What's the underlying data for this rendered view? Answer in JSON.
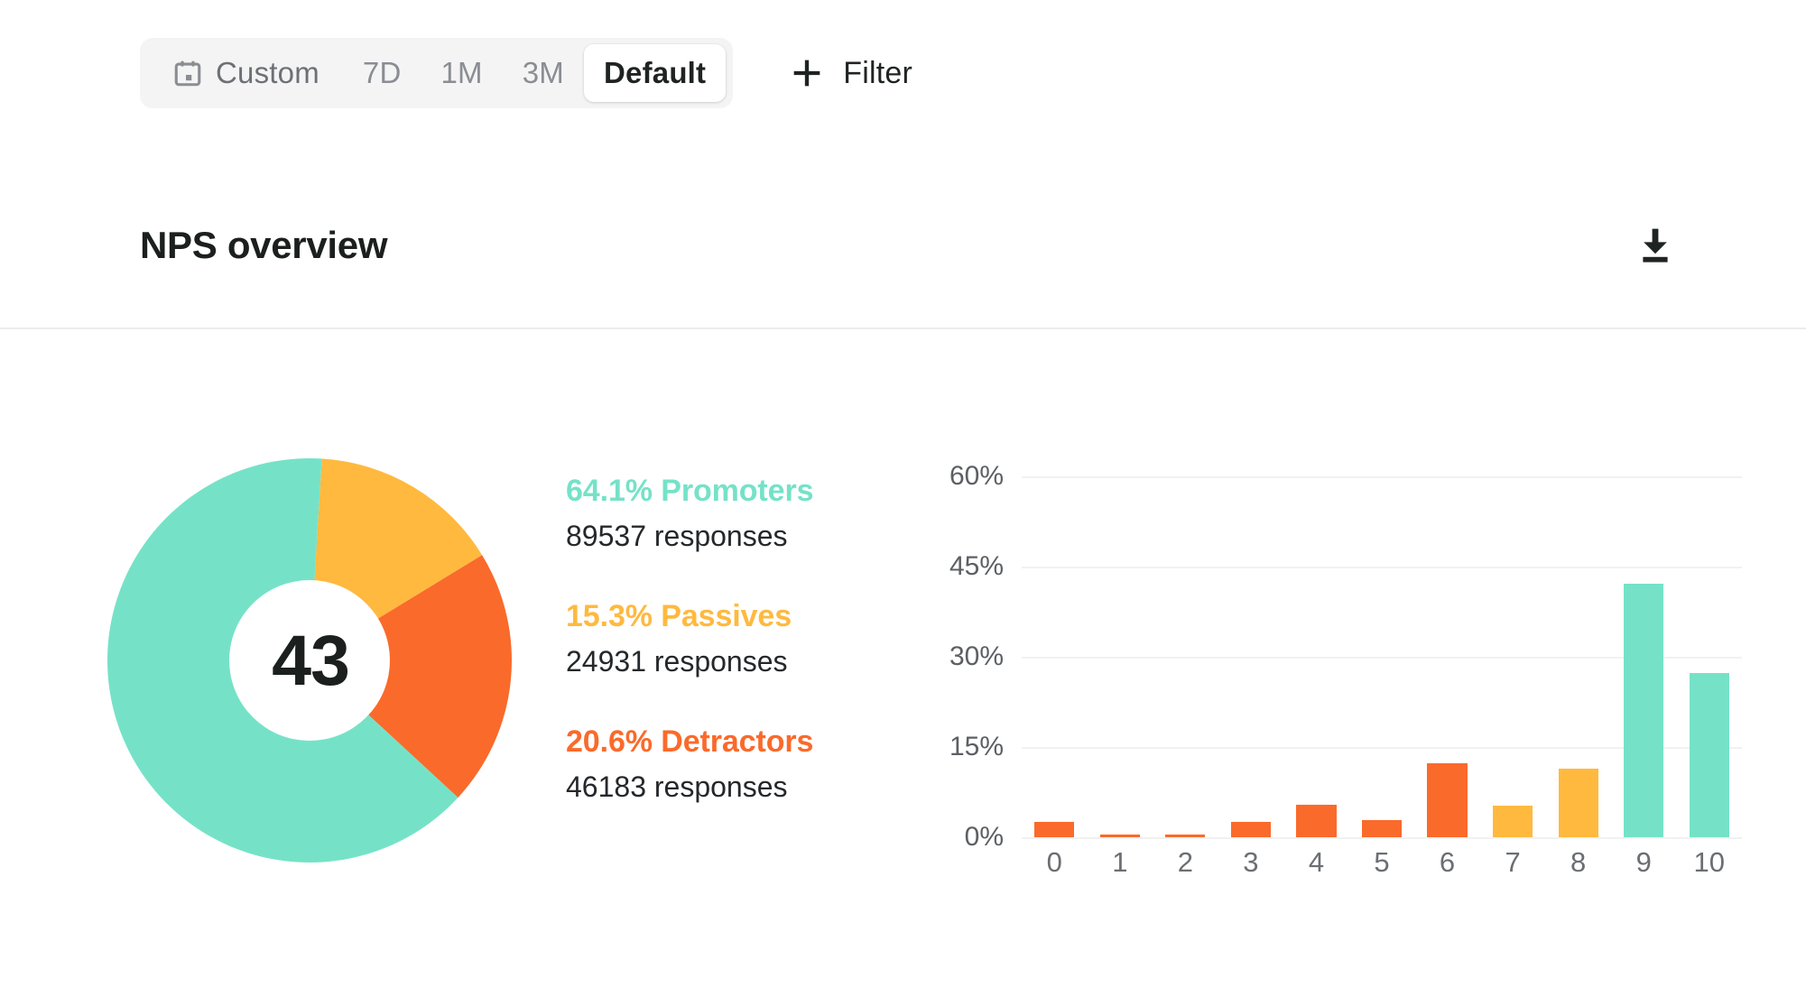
{
  "toolbar": {
    "calendar_icon": "calendar-icon",
    "ranges": [
      {
        "label": "Custom",
        "active": false
      },
      {
        "label": "7D",
        "active": false
      },
      {
        "label": "1M",
        "active": false
      },
      {
        "label": "3M",
        "active": false
      },
      {
        "label": "Default",
        "active": true
      }
    ],
    "filter_label": "Filter",
    "plus_icon": "plus-icon"
  },
  "card": {
    "title": "NPS overview",
    "download_icon": "download-icon"
  },
  "nps": {
    "score": "43",
    "segments": [
      {
        "key": "promoters",
        "percent_label": "64.1% Promoters",
        "responses_label": "89537 responses",
        "percent": 64.1,
        "responses": 89537,
        "color": "#75E2C8"
      },
      {
        "key": "passives",
        "percent_label": "15.3% Passives",
        "responses_label": "24931 responses",
        "percent": 15.3,
        "responses": 24931,
        "color": "#FFB93F"
      },
      {
        "key": "detractors",
        "percent_label": "20.6% Detractors",
        "responses_label": "46183 responses",
        "percent": 20.6,
        "responses": 46183,
        "color": "#FA6A2B"
      }
    ]
  },
  "colors": {
    "promoter": "#75E2C8",
    "passive": "#FFB93F",
    "detractor": "#FA6A2B",
    "text": "#1b1f1e",
    "muted": "#8b8d93",
    "grid": "#f1f1f1",
    "toolbar_bg": "#f4f4f5"
  },
  "chart_data": {
    "type": "bar",
    "title": "",
    "xlabel": "",
    "ylabel": "",
    "categories": [
      "0",
      "1",
      "2",
      "3",
      "4",
      "5",
      "6",
      "7",
      "8",
      "9",
      "10"
    ],
    "values": [
      2.6,
      0.4,
      0.4,
      2.6,
      5.4,
      2.8,
      12.3,
      5.2,
      11.4,
      42.2,
      27.3
    ],
    "bar_colors": [
      "#FA6A2B",
      "#FA6A2B",
      "#FA6A2B",
      "#FA6A2B",
      "#FA6A2B",
      "#FA6A2B",
      "#FA6A2B",
      "#FFB93F",
      "#FFB93F",
      "#75E2C8",
      "#75E2C8"
    ],
    "ylim": [
      0,
      60
    ],
    "yticks": [
      0,
      15,
      30,
      45,
      60
    ],
    "ytick_labels": [
      "0%",
      "15%",
      "30%",
      "45%",
      "60%"
    ],
    "grid": true,
    "legend": "none"
  }
}
